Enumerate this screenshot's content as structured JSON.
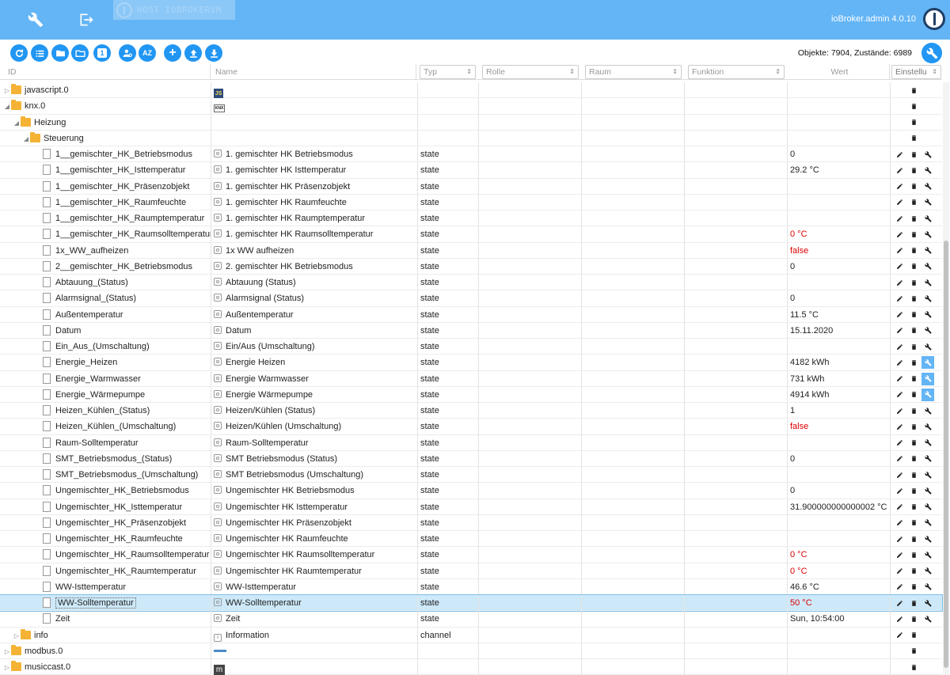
{
  "topbar": {
    "host": "HOST IOBROKERVM",
    "version": "ioBroker.admin 4.0.10",
    "icons": [
      "wrench-icon",
      "logout-icon",
      "iobroker-logo-icon"
    ]
  },
  "toolbar": {
    "counts": "Objekte: 7904, Zustände: 6989",
    "buttons": [
      {
        "name": "refresh-icon",
        "text": ""
      },
      {
        "name": "list-view-icon",
        "text": ""
      },
      {
        "name": "folder-open-icon",
        "text": ""
      },
      {
        "name": "folder-closed-icon",
        "text": ""
      },
      {
        "name": "one-level-icon",
        "text": "1"
      },
      {
        "name": "person-settings-icon",
        "text": ""
      },
      {
        "name": "sort-az-icon",
        "text": "AZ"
      },
      {
        "name": "add-icon",
        "text": "+"
      },
      {
        "name": "upload-icon",
        "text": ""
      },
      {
        "name": "download-icon",
        "text": ""
      }
    ]
  },
  "columns": {
    "id": "ID",
    "name": "Name",
    "typ": "Typ",
    "rolle": "Rolle",
    "raum": "Raum",
    "funktion": "Funktion",
    "wert": "Wert",
    "einstellungen": "Einstellu"
  },
  "rows": [
    {
      "indent": 0,
      "tri": "▷",
      "kind": "folder",
      "id": "javascript.0",
      "nameIcon": "js",
      "nameIconText": "JS",
      "name": "",
      "typ": "",
      "wert": "",
      "red": false,
      "acts": [
        "del"
      ],
      "hl": []
    },
    {
      "indent": 0,
      "tri": "◢",
      "kind": "folder",
      "id": "knx.0",
      "nameIcon": "knx",
      "nameIconText": "KNX",
      "name": "",
      "typ": "",
      "wert": "",
      "red": false,
      "acts": [
        "del"
      ],
      "hl": []
    },
    {
      "indent": 1,
      "tri": "◢",
      "kind": "folder",
      "id": "Heizung",
      "nameIcon": "",
      "name": "",
      "typ": "",
      "wert": "",
      "red": false,
      "acts": [
        "del"
      ],
      "hl": []
    },
    {
      "indent": 2,
      "tri": "◢",
      "kind": "folder",
      "id": "Steuerung",
      "nameIcon": "",
      "name": "",
      "typ": "",
      "wert": "",
      "red": false,
      "acts": [
        "del"
      ],
      "hl": []
    },
    {
      "indent": 3,
      "kind": "file",
      "id": "1__gemischter_HK_Betriebsmodus",
      "nameIcon": "state",
      "name": "1. gemischter HK Betriebsmodus",
      "typ": "state",
      "wert": "0",
      "red": false,
      "acts": [
        "edit",
        "del",
        "wrench"
      ],
      "hl": []
    },
    {
      "indent": 3,
      "kind": "file",
      "id": "1__gemischter_HK_Isttemperatur",
      "nameIcon": "state",
      "name": "1. gemischter HK Isttemperatur",
      "typ": "state",
      "wert": "29.2 °C",
      "red": false,
      "acts": [
        "edit",
        "del",
        "wrench"
      ],
      "hl": []
    },
    {
      "indent": 3,
      "kind": "file",
      "id": "1__gemischter_HK_Präsenzobjekt",
      "nameIcon": "state",
      "name": "1. gemischter HK Präsenzobjekt",
      "typ": "state",
      "wert": "",
      "red": false,
      "acts": [
        "edit",
        "del",
        "wrench"
      ],
      "hl": []
    },
    {
      "indent": 3,
      "kind": "file",
      "id": "1__gemischter_HK_Raumfeuchte",
      "nameIcon": "state",
      "name": "1. gemischter HK Raumfeuchte",
      "typ": "state",
      "wert": "",
      "red": false,
      "acts": [
        "edit",
        "del",
        "wrench"
      ],
      "hl": []
    },
    {
      "indent": 3,
      "kind": "file",
      "id": "1__gemischter_HK_Raumptemperatur",
      "nameIcon": "state",
      "name": "1. gemischter HK Raumptemperatur",
      "typ": "state",
      "wert": "",
      "red": false,
      "acts": [
        "edit",
        "del",
        "wrench"
      ],
      "hl": []
    },
    {
      "indent": 3,
      "kind": "file",
      "id": "1__gemischter_HK_Raumsolltemperatur",
      "nameIcon": "state",
      "name": "1. gemischter HK Raumsolltemperatur",
      "typ": "state",
      "wert": "0 °C",
      "red": true,
      "acts": [
        "edit",
        "del",
        "wrench"
      ],
      "hl": []
    },
    {
      "indent": 3,
      "kind": "file",
      "id": "1x_WW_aufheizen",
      "nameIcon": "state",
      "name": "1x WW aufheizen",
      "typ": "state",
      "wert": "false",
      "red": true,
      "acts": [
        "edit",
        "del",
        "wrench"
      ],
      "hl": []
    },
    {
      "indent": 3,
      "kind": "file",
      "id": "2__gemischter_HK_Betriebsmodus",
      "nameIcon": "state",
      "name": "2. gemischter HK Betriebsmodus",
      "typ": "state",
      "wert": "0",
      "red": false,
      "acts": [
        "edit",
        "del",
        "wrench"
      ],
      "hl": []
    },
    {
      "indent": 3,
      "kind": "file",
      "id": "Abtauung_(Status)",
      "nameIcon": "state",
      "name": "Abtauung (Status)",
      "typ": "state",
      "wert": "",
      "red": false,
      "acts": [
        "edit",
        "del",
        "wrench"
      ],
      "hl": []
    },
    {
      "indent": 3,
      "kind": "file",
      "id": "Alarmsignal_(Status)",
      "nameIcon": "state",
      "name": "Alarmsignal (Status)",
      "typ": "state",
      "wert": "0",
      "red": false,
      "acts": [
        "edit",
        "del",
        "wrench"
      ],
      "hl": []
    },
    {
      "indent": 3,
      "kind": "file",
      "id": "Außentemperatur",
      "nameIcon": "state",
      "name": "Außentemperatur",
      "typ": "state",
      "wert": "11.5 °C",
      "red": false,
      "acts": [
        "edit",
        "del",
        "wrench"
      ],
      "hl": []
    },
    {
      "indent": 3,
      "kind": "file",
      "id": "Datum",
      "nameIcon": "state",
      "name": "Datum",
      "typ": "state",
      "wert": "15.11.2020",
      "red": false,
      "acts": [
        "edit",
        "del",
        "wrench"
      ],
      "hl": []
    },
    {
      "indent": 3,
      "kind": "file",
      "id": "Ein_Aus_(Umschaltung)",
      "nameIcon": "state",
      "name": "Ein/Aus (Umschaltung)",
      "typ": "state",
      "wert": "",
      "red": false,
      "acts": [
        "edit",
        "del",
        "wrench"
      ],
      "hl": []
    },
    {
      "indent": 3,
      "kind": "file",
      "id": "Energie_Heizen",
      "nameIcon": "state",
      "name": "Energie Heizen",
      "typ": "state",
      "wert": "4182 kWh",
      "red": false,
      "acts": [
        "edit",
        "del",
        "wrench"
      ],
      "hl": [
        "wrench"
      ]
    },
    {
      "indent": 3,
      "kind": "file",
      "id": "Energie_Warmwasser",
      "nameIcon": "state",
      "name": "Energie Warmwasser",
      "typ": "state",
      "wert": "731 kWh",
      "red": false,
      "acts": [
        "edit",
        "del",
        "wrench"
      ],
      "hl": [
        "wrench"
      ]
    },
    {
      "indent": 3,
      "kind": "file",
      "id": "Energie_Wärmepumpe",
      "nameIcon": "state",
      "name": "Energie Wärmepumpe",
      "typ": "state",
      "wert": "4914 kWh",
      "red": false,
      "acts": [
        "edit",
        "del",
        "wrench"
      ],
      "hl": [
        "wrench"
      ]
    },
    {
      "indent": 3,
      "kind": "file",
      "id": "Heizen_Kühlen_(Status)",
      "nameIcon": "state",
      "name": "Heizen/Kühlen (Status)",
      "typ": "state",
      "wert": "1",
      "red": false,
      "acts": [
        "edit",
        "del",
        "wrench"
      ],
      "hl": []
    },
    {
      "indent": 3,
      "kind": "file",
      "id": "Heizen_Kühlen_(Umschaltung)",
      "nameIcon": "state",
      "name": "Heizen/Kühlen (Umschaltung)",
      "typ": "state",
      "wert": "false",
      "red": true,
      "acts": [
        "edit",
        "del",
        "wrench"
      ],
      "hl": []
    },
    {
      "indent": 3,
      "kind": "file",
      "id": "Raum-Solltemperatur",
      "nameIcon": "state",
      "name": "Raum-Solltemperatur",
      "typ": "state",
      "wert": "",
      "red": false,
      "acts": [
        "edit",
        "del",
        "wrench"
      ],
      "hl": []
    },
    {
      "indent": 3,
      "kind": "file",
      "id": "SMT_Betriebsmodus_(Status)",
      "nameIcon": "state",
      "name": "SMT Betriebsmodus (Status)",
      "typ": "state",
      "wert": "0",
      "red": false,
      "acts": [
        "edit",
        "del",
        "wrench"
      ],
      "hl": []
    },
    {
      "indent": 3,
      "kind": "file",
      "id": "SMT_Betriebsmodus_(Umschaltung)",
      "nameIcon": "state",
      "name": "SMT Betriebsmodus (Umschaltung)",
      "typ": "state",
      "wert": "",
      "red": false,
      "acts": [
        "edit",
        "del",
        "wrench"
      ],
      "hl": []
    },
    {
      "indent": 3,
      "kind": "file",
      "id": "Ungemischter_HK_Betriebsmodus",
      "nameIcon": "state",
      "name": "Ungemischter HK Betriebsmodus",
      "typ": "state",
      "wert": "0",
      "red": false,
      "acts": [
        "edit",
        "del",
        "wrench"
      ],
      "hl": []
    },
    {
      "indent": 3,
      "kind": "file",
      "id": "Ungemischter_HK_Isttemperatur",
      "nameIcon": "state",
      "name": "Ungemischter HK Isttemperatur",
      "typ": "state",
      "wert": "31.900000000000002 °C",
      "red": false,
      "acts": [
        "edit",
        "del",
        "wrench"
      ],
      "hl": []
    },
    {
      "indent": 3,
      "kind": "file",
      "id": "Ungemischter_HK_Präsenzobjekt",
      "nameIcon": "state",
      "name": "Ungemischter HK Präsenzobjekt",
      "typ": "state",
      "wert": "",
      "red": false,
      "acts": [
        "edit",
        "del",
        "wrench"
      ],
      "hl": []
    },
    {
      "indent": 3,
      "kind": "file",
      "id": "Ungemischter_HK_Raumfeuchte",
      "nameIcon": "state",
      "name": "Ungemischter HK Raumfeuchte",
      "typ": "state",
      "wert": "",
      "red": false,
      "acts": [
        "edit",
        "del",
        "wrench"
      ],
      "hl": []
    },
    {
      "indent": 3,
      "kind": "file",
      "id": "Ungemischter_HK_Raumsolltemperatur",
      "nameIcon": "state",
      "name": "Ungemischter HK Raumsolltemperatur",
      "typ": "state",
      "wert": "0 °C",
      "red": true,
      "acts": [
        "edit",
        "del",
        "wrench"
      ],
      "hl": []
    },
    {
      "indent": 3,
      "kind": "file",
      "id": "Ungemischter_HK_Raumtemperatur",
      "nameIcon": "state",
      "name": "Ungemischter HK Raumtemperatur",
      "typ": "state",
      "wert": "0 °C",
      "red": true,
      "acts": [
        "edit",
        "del",
        "wrench"
      ],
      "hl": []
    },
    {
      "indent": 3,
      "kind": "file",
      "id": "WW-Isttemperatur",
      "nameIcon": "state",
      "name": "WW-Isttemperatur",
      "typ": "state",
      "wert": "46.6 °C",
      "red": false,
      "acts": [
        "edit",
        "del",
        "wrench"
      ],
      "hl": []
    },
    {
      "indent": 3,
      "kind": "file",
      "id": "WW-Solltemperatur",
      "nameIcon": "state",
      "name": "WW-Solltemperatur",
      "typ": "state",
      "wert": "50 °C",
      "red": true,
      "acts": [
        "edit",
        "del",
        "wrench"
      ],
      "hl": [],
      "selected": true
    },
    {
      "indent": 3,
      "kind": "file",
      "id": "Zeit",
      "nameIcon": "state",
      "name": "Zeit",
      "typ": "state",
      "wert": "Sun, 10:54:00",
      "red": false,
      "acts": [
        "edit",
        "del",
        "wrench"
      ],
      "hl": []
    },
    {
      "indent": 1,
      "tri": "▷",
      "kind": "folder",
      "id": "info",
      "nameIcon": "info",
      "name": "Information",
      "typ": "channel",
      "wert": "",
      "red": false,
      "acts": [
        "edit",
        "del"
      ],
      "hl": []
    },
    {
      "indent": 0,
      "tri": "▷",
      "kind": "folder",
      "id": "modbus.0",
      "nameIcon": "modbus",
      "name": "",
      "typ": "",
      "wert": "",
      "red": false,
      "acts": [
        "del"
      ],
      "hl": []
    },
    {
      "indent": 0,
      "tri": "▷",
      "kind": "folder",
      "id": "musiccast.0",
      "nameIcon": "mc",
      "nameIconText": "m",
      "name": "",
      "typ": "",
      "wert": "",
      "red": false,
      "acts": [
        "del"
      ],
      "hl": []
    }
  ]
}
